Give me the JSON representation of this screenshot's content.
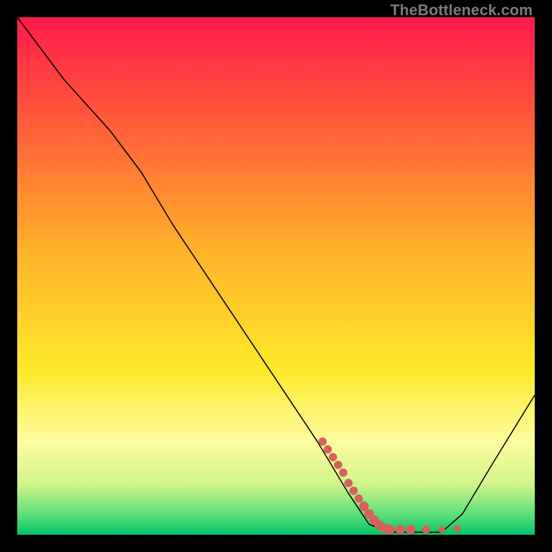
{
  "watermark": "TheBottleneck.com",
  "chart_data": {
    "type": "line",
    "title": "",
    "xlabel": "",
    "ylabel": "",
    "xlim": [
      0,
      100
    ],
    "ylim": [
      0,
      100
    ],
    "grid": false,
    "legend": false,
    "background_gradient": {
      "stops": [
        {
          "offset": 0.0,
          "color": "#ff1a4b"
        },
        {
          "offset": 0.2,
          "color": "#ff5a3a"
        },
        {
          "offset": 0.45,
          "color": "#ffb22a"
        },
        {
          "offset": 0.68,
          "color": "#ffe92a"
        },
        {
          "offset": 0.82,
          "color": "#fdfca0"
        },
        {
          "offset": 0.9,
          "color": "#d3f58a"
        },
        {
          "offset": 0.96,
          "color": "#5fe07a"
        },
        {
          "offset": 1.0,
          "color": "#00c46a"
        }
      ]
    },
    "curve": {
      "color": "#000000",
      "width": 1.6,
      "points": [
        {
          "x": 0,
          "y": 100
        },
        {
          "x": 9,
          "y": 88
        },
        {
          "x": 18,
          "y": 78
        },
        {
          "x": 24,
          "y": 70
        },
        {
          "x": 30,
          "y": 60
        },
        {
          "x": 40,
          "y": 45
        },
        {
          "x": 50,
          "y": 30
        },
        {
          "x": 58,
          "y": 18
        },
        {
          "x": 64,
          "y": 8
        },
        {
          "x": 68,
          "y": 2
        },
        {
          "x": 72,
          "y": 0.5
        },
        {
          "x": 78,
          "y": 0.5
        },
        {
          "x": 82,
          "y": 0.5
        },
        {
          "x": 86,
          "y": 4
        },
        {
          "x": 92,
          "y": 14
        },
        {
          "x": 100,
          "y": 27
        }
      ]
    },
    "marker_trail": {
      "color": "#d6605a",
      "points": [
        {
          "x": 59,
          "y": 18,
          "r": 6
        },
        {
          "x": 60,
          "y": 16.5,
          "r": 6
        },
        {
          "x": 61,
          "y": 15,
          "r": 6
        },
        {
          "x": 62,
          "y": 13.5,
          "r": 6
        },
        {
          "x": 63,
          "y": 12,
          "r": 6
        },
        {
          "x": 64,
          "y": 10,
          "r": 6
        },
        {
          "x": 65,
          "y": 8.5,
          "r": 6
        },
        {
          "x": 66,
          "y": 7,
          "r": 6
        },
        {
          "x": 67,
          "y": 5.5,
          "r": 7
        },
        {
          "x": 68,
          "y": 4,
          "r": 7
        },
        {
          "x": 69,
          "y": 2.8,
          "r": 7
        },
        {
          "x": 70,
          "y": 1.8,
          "r": 7
        },
        {
          "x": 71,
          "y": 1.2,
          "r": 7
        },
        {
          "x": 72,
          "y": 1,
          "r": 7
        },
        {
          "x": 74,
          "y": 1,
          "r": 7
        },
        {
          "x": 76,
          "y": 1,
          "r": 7
        },
        {
          "x": 79,
          "y": 1,
          "r": 6
        },
        {
          "x": 82,
          "y": 1,
          "r": 5
        },
        {
          "x": 85,
          "y": 1.2,
          "r": 5
        }
      ]
    }
  }
}
